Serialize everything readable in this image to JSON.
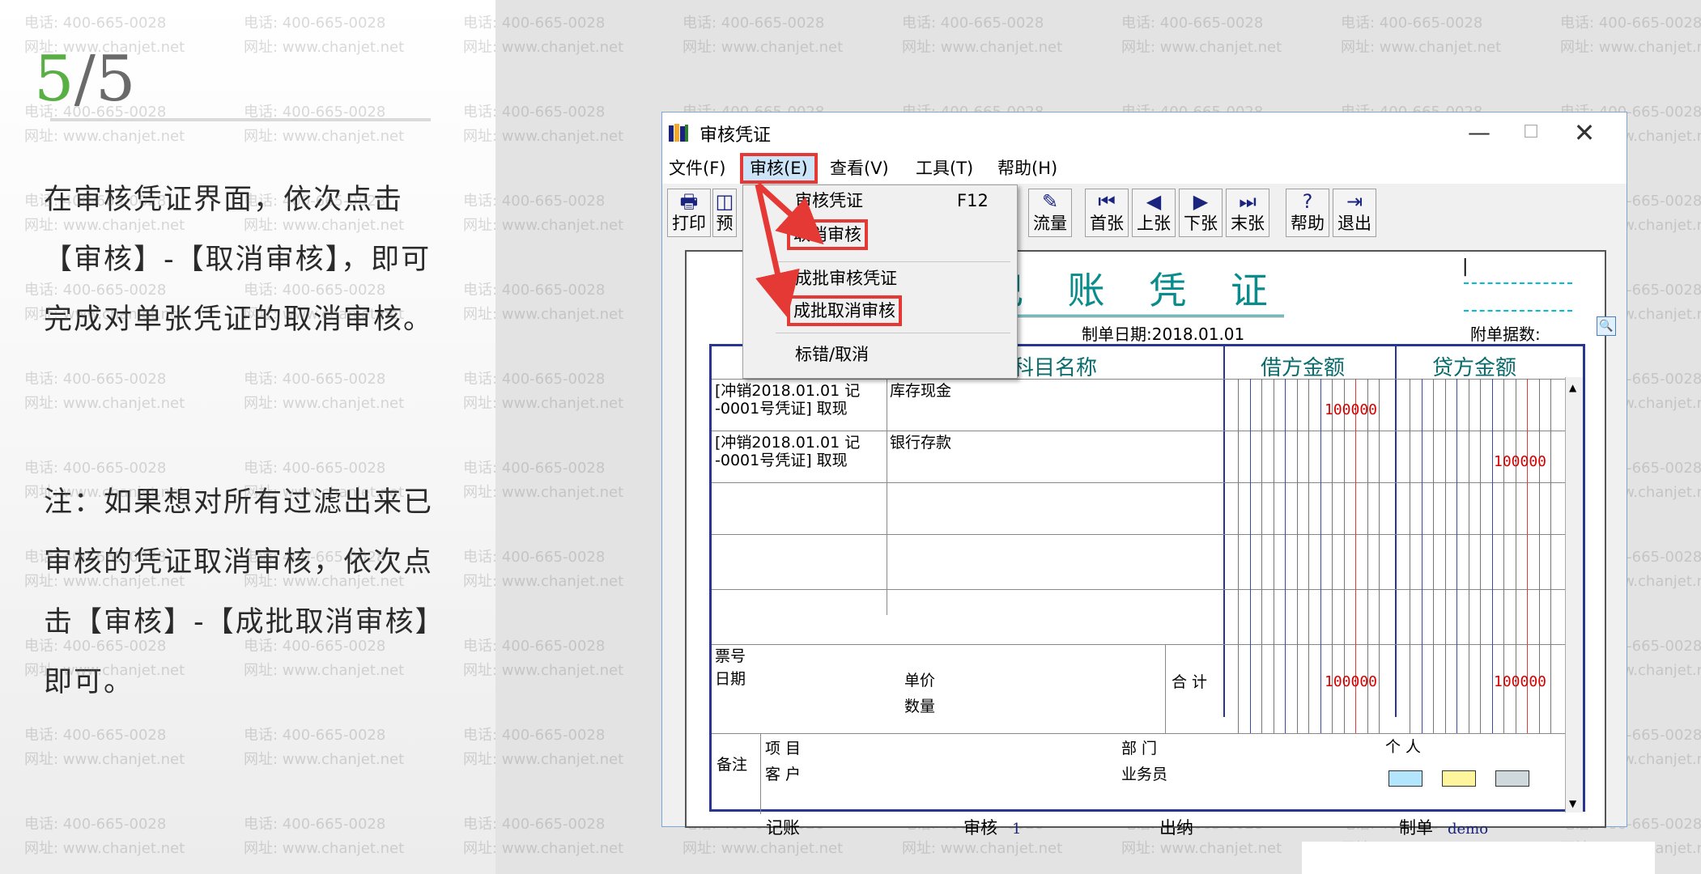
{
  "step": {
    "current": "5",
    "total": "/5"
  },
  "instructions": {
    "para1": "在审核凭证界面，依次点击【审核】-【取消审核】，即可完成对单张凭证的取消审核。",
    "para2": "注：如果想对所有过滤出来已审核的凭证取消审核，依次点击【审核】-【成批取消审核】即可。"
  },
  "watermark": {
    "phone": "电话: 400-665-0028",
    "site": "网址: www.chanjet.net"
  },
  "window": {
    "title": "审核凭证",
    "controls": {
      "minimize": "—",
      "maximize": "☐",
      "close": "✕"
    }
  },
  "menu": [
    {
      "label": "文件(F)"
    },
    {
      "label": "审核(E)"
    },
    {
      "label": "查看(V)"
    },
    {
      "label": "工具(T)"
    },
    {
      "label": "帮助(H)"
    }
  ],
  "toolbar": [
    {
      "label": "打印",
      "icon": "printer-icon",
      "glyph": "🖶"
    },
    {
      "label": "预",
      "icon": "preview-icon",
      "glyph": "◫"
    },
    {
      "label": "流量",
      "icon": "cashflow-icon",
      "glyph": "✎"
    },
    {
      "label": "首张",
      "icon": "first-icon",
      "glyph": "⏮"
    },
    {
      "label": "上张",
      "icon": "prev-icon",
      "glyph": "◀"
    },
    {
      "label": "下张",
      "icon": "next-icon",
      "glyph": "▶"
    },
    {
      "label": "末张",
      "icon": "last-icon",
      "glyph": "⏭"
    },
    {
      "label": "帮助",
      "icon": "help-icon",
      "glyph": "?"
    },
    {
      "label": "退出",
      "icon": "exit-icon",
      "glyph": "⇥"
    }
  ],
  "dropdown": {
    "items": [
      {
        "label": "审核凭证",
        "shortcut": "F12"
      },
      {
        "label": "取消审核"
      },
      {
        "label": "成批审核凭证"
      },
      {
        "label": "成批取消审核"
      },
      {
        "label": "标错/取消"
      }
    ]
  },
  "voucher": {
    "title": "记 账 凭 证",
    "date_label": "制单日期:2018.01.01",
    "attach_label": "附单据数:",
    "columns": {
      "subject": "科目名称",
      "debit": "借方金额",
      "credit": "贷方金额"
    },
    "rows": [
      {
        "summary_1": "[冲销2018.01.01 记",
        "summary_2": "-0001号凭证] 取现",
        "subject": "库存现金",
        "debit": "100000",
        "credit": ""
      },
      {
        "summary_1": "[冲销2018.01.01 记",
        "summary_2": "-0001号凭证] 取现",
        "subject": "银行存款",
        "debit": "",
        "credit": "100000"
      }
    ],
    "footer": {
      "ticket_no": "票号",
      "date": "日期",
      "unit_price": "单价",
      "quantity": "数量",
      "total_label": "合 计",
      "total_debit": "100000",
      "total_credit": "100000",
      "remark": "备注",
      "project": "项  目",
      "customer": "客  户",
      "department": "部  门",
      "salesperson": "业务员",
      "person": "个  人"
    },
    "signatures": {
      "bookkeeper": "记账",
      "auditor_label": "审核",
      "auditor_value": "1",
      "cashier": "出纳",
      "maker_label": "制单",
      "maker_value": "demo"
    }
  },
  "colors": {
    "highlight": "#e53935",
    "title_teal": "#0a8c8c",
    "grid_blue": "#283593",
    "amount_red": "#d50000"
  }
}
